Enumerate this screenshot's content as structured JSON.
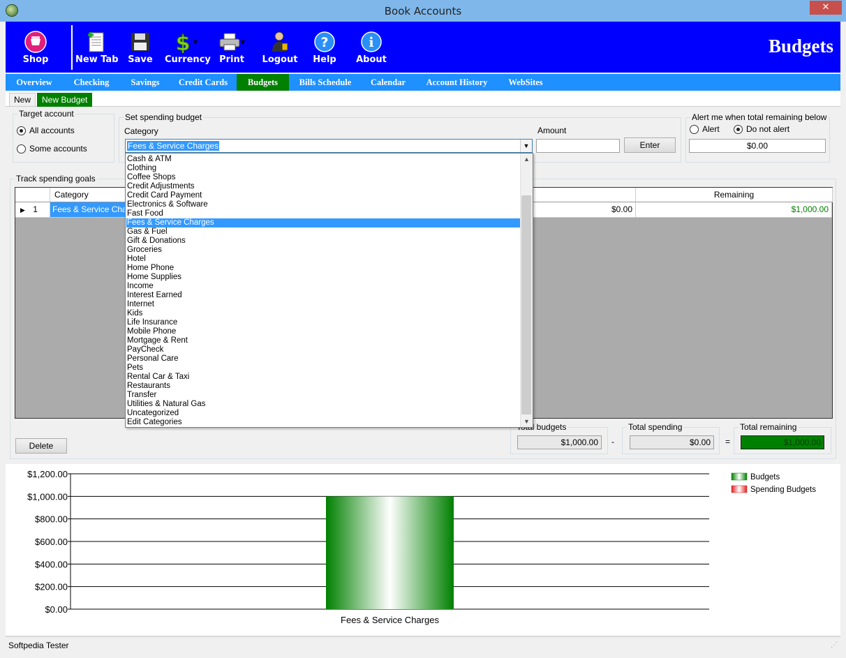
{
  "window": {
    "title": "Book Accounts",
    "close_glyph": "✕"
  },
  "toolbar": {
    "shop_label": "Shop",
    "items": [
      {
        "label": "New Tab",
        "icon": "new-tab-icon"
      },
      {
        "label": "Save",
        "icon": "floppy-disk-icon"
      },
      {
        "label": "Currency",
        "icon": "dollar-icon"
      },
      {
        "label": "Print",
        "icon": "printer-icon"
      },
      {
        "label": "Logout",
        "icon": "user-logout-icon"
      },
      {
        "label": "Help",
        "icon": "help-icon"
      },
      {
        "label": "About",
        "icon": "info-icon"
      }
    ],
    "page_title": "Budgets"
  },
  "nav": {
    "tabs": [
      "Overview",
      "Checking",
      "Savings",
      "Credit Cards",
      "Budgets",
      "Bills Schedule",
      "Calendar",
      "Account History",
      "WebSites"
    ],
    "active": "Budgets"
  },
  "subtabs": {
    "new": "New",
    "new_budget": "New Budget"
  },
  "target_account": {
    "legend": "Target account",
    "all": "All accounts",
    "some": "Some accounts",
    "selected": "All accounts"
  },
  "spending": {
    "legend": "Set spending budget",
    "category_label": "Category",
    "category_value": "Fees & Service Charges",
    "amount_label": "Amount",
    "amount_value": "",
    "enter_button": "Enter"
  },
  "alert": {
    "legend": "Alert me when  total remaining below",
    "alert_option": "Alert",
    "no_alert_option": "Do not alert",
    "selected": "Do not alert",
    "threshold": "$0.00"
  },
  "dropdown": {
    "items": [
      "Cash & ATM",
      "Clothing",
      "Coffee Shops",
      "Credit Adjustments",
      "Credit Card Payment",
      "Electronics & Software",
      "Fast Food",
      "Fees & Service Charges",
      "Gas & Fuel",
      "Gift & Donations",
      "Groceries",
      "Hotel",
      "Home Phone",
      "Home Supplies",
      "Income",
      "Interest Earned",
      "Internet",
      "Kids",
      "Life Insurance",
      "Mobile Phone",
      "Mortgage & Rent",
      "PayCheck",
      "Personal Care",
      "Pets",
      "Rental Car & Taxi",
      "Restaurants",
      "Transfer",
      "Utilities & Natural Gas",
      "Uncategorized",
      "Edit Categories"
    ],
    "selected": "Fees & Service Charges"
  },
  "goals": {
    "legend": "Track spending goals",
    "columns": {
      "category": "Category",
      "remaining": "Remaining"
    },
    "rows": [
      {
        "num": "1",
        "category": "Fees & Service Charges",
        "spent": "$0.00",
        "remaining": "$1,000.00"
      }
    ],
    "delete_button": "Delete"
  },
  "totals": {
    "budgets_label": "Total budgets",
    "budgets_value": "$1,000.00",
    "minus": "-",
    "spending_label": "Total spending",
    "spending_value": "$0.00",
    "equals": "=",
    "remaining_label": "Total remaining",
    "remaining_value": "$1,000.00"
  },
  "chart_data": {
    "type": "bar",
    "categories": [
      "Fees & Service Charges"
    ],
    "series": [
      {
        "name": "Budgets",
        "values": [
          1000
        ],
        "color": "#008000"
      },
      {
        "name": "Spending Budgets",
        "values": [
          0
        ],
        "color": "#e02020"
      }
    ],
    "ylim": [
      0,
      1200
    ],
    "yticks": [
      "$0.00",
      "$200.00",
      "$400.00",
      "$600.00",
      "$800.00",
      "$1,000.00",
      "$1,200.00"
    ],
    "grid": true,
    "legend_position": "top-right"
  },
  "status": {
    "text": "Softpedia Tester"
  }
}
